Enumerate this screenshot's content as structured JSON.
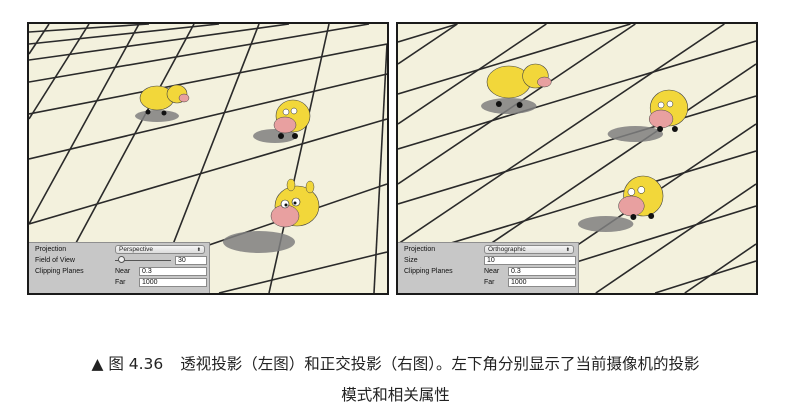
{
  "figure": {
    "marker": "▲",
    "number": "图 4.36",
    "caption_line1": "透视投影（左图）和正交投影（右图）。左下角分别显示了当前摄像机的投影",
    "caption_line2": "模式和相关属性"
  },
  "left_view": {
    "projection_label": "Projection",
    "projection_value": "Perspective",
    "fov_label": "Field of View",
    "fov_value": "30",
    "fov_slider_fraction": 0.1,
    "clipping_label": "Clipping Planes",
    "near_label": "Near",
    "near_value": "0.3",
    "far_label": "Far",
    "far_value": "1000"
  },
  "right_view": {
    "projection_label": "Projection",
    "projection_value": "Orthographic",
    "size_label": "Size",
    "size_value": "10",
    "clipping_label": "Clipping Planes",
    "near_label": "Near",
    "near_value": "0.3",
    "far_label": "Far",
    "far_value": "1000"
  },
  "colors": {
    "ground": "#f3f1dd",
    "grid": "#2a2a2a",
    "cow_body": "#f2d73a",
    "cow_nose": "#e8a0a0",
    "shadow": "#7f7f7f"
  }
}
